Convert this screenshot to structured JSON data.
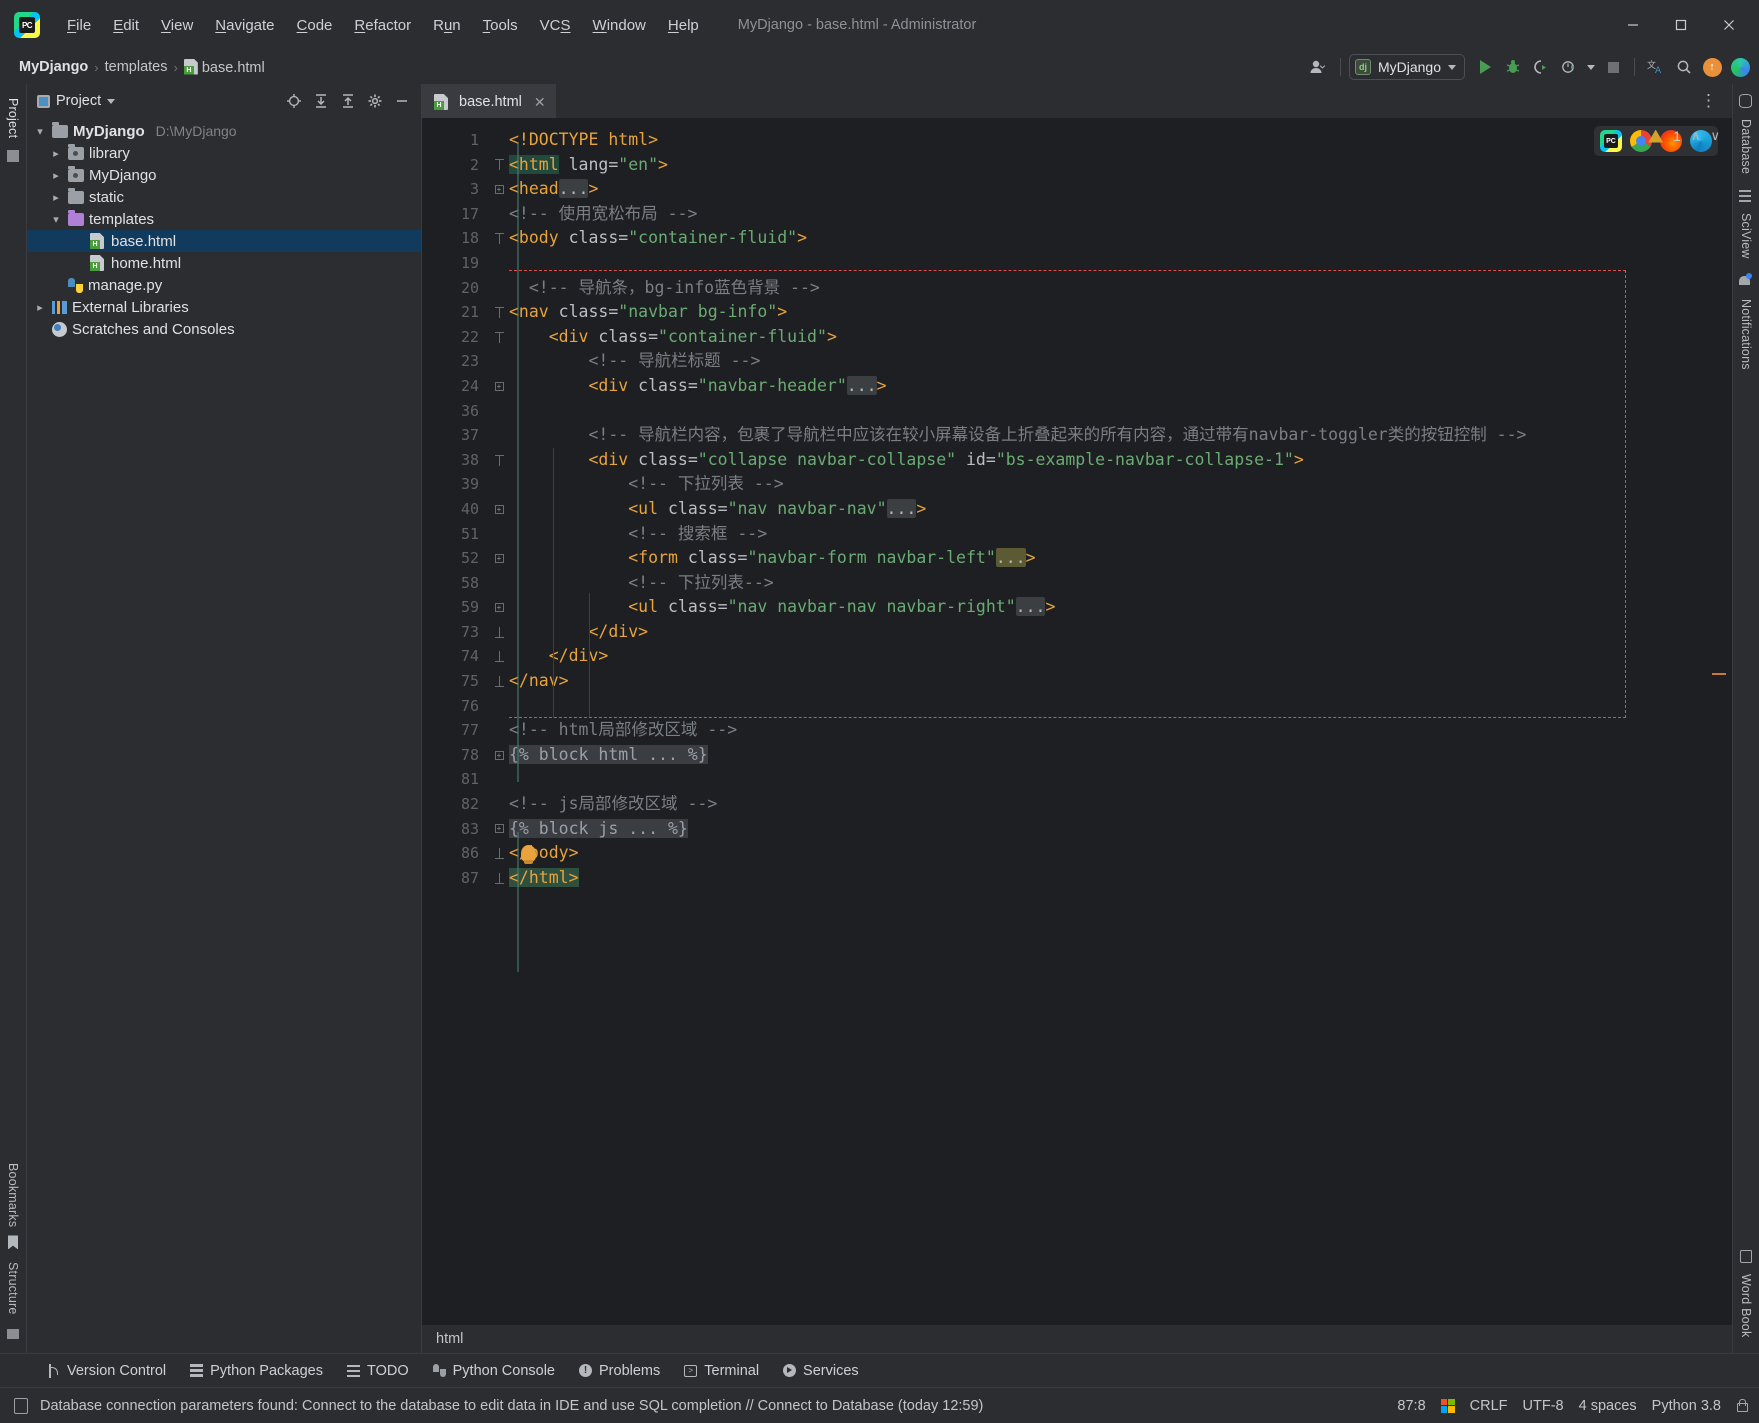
{
  "window": {
    "title": "MyDjango - base.html - Administrator",
    "minimize": "—",
    "maximize": "☐",
    "close": "✕"
  },
  "menu": {
    "items": [
      {
        "label": "File",
        "mnemonic": "F"
      },
      {
        "label": "Edit",
        "mnemonic": "E"
      },
      {
        "label": "View",
        "mnemonic": "V"
      },
      {
        "label": "Navigate",
        "mnemonic": "N"
      },
      {
        "label": "Code",
        "mnemonic": "C"
      },
      {
        "label": "Refactor",
        "mnemonic": "R"
      },
      {
        "label": "Run",
        "mnemonic": "u"
      },
      {
        "label": "Tools",
        "mnemonic": "T"
      },
      {
        "label": "VCS",
        "mnemonic": "S"
      },
      {
        "label": "Window",
        "mnemonic": "W"
      },
      {
        "label": "Help",
        "mnemonic": "H"
      }
    ]
  },
  "breadcrumb": {
    "project": "MyDjango",
    "folder": "templates",
    "file": "base.html",
    "separator": "›"
  },
  "toolbar": {
    "run_config": "MyDjango",
    "django_badge": "dj",
    "icons": [
      "user-account-icon",
      "run-icon",
      "debug-icon",
      "coverage-icon",
      "profile-icon",
      "stop-icon",
      "translate-icon",
      "search-everywhere-icon",
      "update-icon",
      "ai-assistant-icon"
    ]
  },
  "left_rail": {
    "top": [
      "Project"
    ],
    "bottom": [
      "Bookmarks",
      "Structure"
    ]
  },
  "right_rail": {
    "top": [
      "Database",
      "SciView",
      "Notifications"
    ],
    "bottom": [
      "Word Book"
    ]
  },
  "project_panel": {
    "title": "Project",
    "header_icons": [
      "locate-icon",
      "expand-all-icon",
      "collapse-all-icon",
      "settings-gear-icon",
      "hide-icon"
    ],
    "tree": [
      {
        "label": "MyDjango",
        "path": "D:\\MyDjango",
        "indent": 0,
        "chevron": "expanded",
        "icon": "folder",
        "bold": true,
        "selected": false
      },
      {
        "label": "library",
        "path": "",
        "indent": 1,
        "chevron": "collapsed",
        "icon": "folder-module",
        "bold": false,
        "selected": false
      },
      {
        "label": "MyDjango",
        "path": "",
        "indent": 1,
        "chevron": "collapsed",
        "icon": "folder-module",
        "bold": false,
        "selected": false
      },
      {
        "label": "static",
        "path": "",
        "indent": 1,
        "chevron": "collapsed",
        "icon": "folder",
        "bold": false,
        "selected": false
      },
      {
        "label": "templates",
        "path": "",
        "indent": 1,
        "chevron": "expanded",
        "icon": "folder-templates",
        "bold": false,
        "selected": false
      },
      {
        "label": "base.html",
        "path": "",
        "indent": 2,
        "chevron": "none",
        "icon": "html-file",
        "bold": false,
        "selected": true
      },
      {
        "label": "home.html",
        "path": "",
        "indent": 2,
        "chevron": "none",
        "icon": "html-file",
        "bold": false,
        "selected": false
      },
      {
        "label": "manage.py",
        "path": "",
        "indent": 1,
        "chevron": "none",
        "icon": "python-file",
        "bold": false,
        "selected": false
      },
      {
        "label": "External Libraries",
        "path": "",
        "indent": 0,
        "chevron": "collapsed",
        "icon": "library",
        "bold": false,
        "selected": false
      },
      {
        "label": "Scratches and Consoles",
        "path": "",
        "indent": 0,
        "chevron": "none",
        "icon": "scratches",
        "bold": false,
        "selected": false
      }
    ]
  },
  "editor": {
    "tab": {
      "label": "base.html",
      "close": "✕",
      "icon": "html-file"
    },
    "overflow_menu": "⋮",
    "inspection": {
      "warning_count": "1",
      "up": "∧",
      "down": "∨"
    },
    "browser_icons": [
      "pycharm-preview-icon",
      "chrome-icon",
      "firefox-icon",
      "edge-icon"
    ],
    "path_status": "html",
    "lines": [
      {
        "num": "1",
        "fold": "",
        "html": "<span class=\"tag\">&lt;!DOCTYPE html&gt;</span>"
      },
      {
        "num": "2",
        "fold": "down",
        "html": "<span class=\"hl\"><span class=\"tag\">&lt;html</span></span><span class=\"attr\"> lang=</span><span class=\"val\">\"en\"</span><span class=\"tag\">&gt;</span>"
      },
      {
        "num": "3",
        "fold": "plus",
        "html": "<span class=\"tag\">&lt;head</span><span class=\"ell\">...</span><span class=\"tag\">&gt;</span>"
      },
      {
        "num": "17",
        "fold": "",
        "html": "<span class=\"cmt\">&lt;!-- 使用宽松布局 --&gt;</span>"
      },
      {
        "num": "18",
        "fold": "down",
        "html": "<span class=\"tag\">&lt;body</span><span class=\"attr\"> class=</span><span class=\"val\">\"container-fluid\"</span><span class=\"tag\">&gt;</span>"
      },
      {
        "num": "19",
        "fold": "",
        "html": ""
      },
      {
        "num": "20",
        "fold": "",
        "html": "  <span class=\"cmt\">&lt;!-- 导航条，bg-info蓝色背景 --&gt;</span>"
      },
      {
        "num": "21",
        "fold": "down",
        "html": "<span class=\"tag\">&lt;nav</span><span class=\"attr\"> class=</span><span class=\"val\">\"navbar bg-info\"</span><span class=\"tag\">&gt;</span>"
      },
      {
        "num": "22",
        "fold": "down",
        "html": "    <span class=\"tag\">&lt;div</span><span class=\"attr\"> class=</span><span class=\"val\">\"container-fluid\"</span><span class=\"tag\">&gt;</span>"
      },
      {
        "num": "23",
        "fold": "",
        "html": "        <span class=\"cmt\">&lt;!-- 导航栏标题 --&gt;</span>"
      },
      {
        "num": "24",
        "fold": "plus",
        "html": "        <span class=\"tag\">&lt;div</span><span class=\"attr\"> class=</span><span class=\"val\">\"navbar-header\"</span><span class=\"ell\">...</span><span class=\"tag\">&gt;</span>"
      },
      {
        "num": "36",
        "fold": "",
        "html": ""
      },
      {
        "num": "37",
        "fold": "",
        "html": "        <span class=\"cmt\">&lt;!-- 导航栏内容，包裹了导航栏中应该在较小屏幕设备上折叠起来的所有内容，通过带有navbar-toggler类的按钮控制 --&gt;</span>"
      },
      {
        "num": "38",
        "fold": "down",
        "html": "        <span class=\"tag\">&lt;div</span><span class=\"attr\"> class=</span><span class=\"val\">\"collapse navbar-collapse\"</span><span class=\"attr\"> id=</span><span class=\"val\">\"bs-example-navbar-collapse-1\"</span><span class=\"tag\">&gt;</span>"
      },
      {
        "num": "39",
        "fold": "",
        "html": "            <span class=\"cmt\">&lt;!-- 下拉列表 --&gt;</span>"
      },
      {
        "num": "40",
        "fold": "plus",
        "html": "            <span class=\"tag\">&lt;ul</span><span class=\"attr\"> class=</span><span class=\"val\">\"nav navbar-nav\"</span><span class=\"ell\">...</span><span class=\"tag\">&gt;</span>"
      },
      {
        "num": "51",
        "fold": "",
        "html": "            <span class=\"cmt\">&lt;!-- 搜索框 --&gt;</span>"
      },
      {
        "num": "52",
        "fold": "plus",
        "html": "            <span class=\"tag\">&lt;form</span><span class=\"attr\"> class=</span><span class=\"val\">\"navbar-form navbar-left\"</span><span class=\"ell olive\">...</span><span class=\"tag\">&gt;</span>"
      },
      {
        "num": "58",
        "fold": "",
        "html": "            <span class=\"cmt\">&lt;!-- 下拉列表--&gt;</span>"
      },
      {
        "num": "59",
        "fold": "plus",
        "html": "            <span class=\"tag\">&lt;ul</span><span class=\"attr\"> class=</span><span class=\"val\">\"nav navbar-nav navbar-right\"</span><span class=\"ell\">...</span><span class=\"tag\">&gt;</span>"
      },
      {
        "num": "73",
        "fold": "up",
        "html": "        <span class=\"tag\">&lt;/div&gt;</span>"
      },
      {
        "num": "74",
        "fold": "up",
        "html": "    <span class=\"tag\">&lt;/div&gt;</span>"
      },
      {
        "num": "75",
        "fold": "up",
        "html": "<span class=\"tag\">&lt;/nav&gt;</span>"
      },
      {
        "num": "76",
        "fold": "",
        "html": ""
      },
      {
        "num": "77",
        "fold": "",
        "html": "<span class=\"cmt\">&lt;!-- html局部修改区域 --&gt;</span>"
      },
      {
        "num": "78",
        "fold": "plus",
        "html": "<span class=\"blockhl\">{% block html ... %}</span>"
      },
      {
        "num": "81",
        "fold": "",
        "html": ""
      },
      {
        "num": "82",
        "fold": "",
        "html": "<span class=\"cmt\">&lt;!-- js局部修改区域 --&gt;</span>"
      },
      {
        "num": "83",
        "fold": "plus",
        "html": "<span class=\"blockhl\">{% block js ... %}</span>"
      },
      {
        "num": "86",
        "fold": "up",
        "html": "<span class=\"tag\">&lt;/body&gt;</span>"
      },
      {
        "num": "87",
        "fold": "up",
        "html": "<span class=\"hl2\"><span class=\"tag\">&lt;/html&gt;</span></span>"
      }
    ]
  },
  "tool_windows": {
    "items": [
      {
        "label": "Version Control",
        "icon": "version-control-icon"
      },
      {
        "label": "Python Packages",
        "icon": "python-packages-icon"
      },
      {
        "label": "TODO",
        "icon": "todo-icon"
      },
      {
        "label": "Python Console",
        "icon": "python-console-icon"
      },
      {
        "label": "Problems",
        "icon": "problems-icon"
      },
      {
        "label": "Terminal",
        "icon": "terminal-icon"
      },
      {
        "label": "Services",
        "icon": "services-icon"
      }
    ]
  },
  "status_bar": {
    "message": "Database connection parameters found: Connect to the database to edit data in IDE and use SQL completion // Connect to Database (today 12:59)",
    "caret": "87:8",
    "line_separator": "CRLF",
    "encoding": "UTF-8",
    "indent": "4 spaces",
    "interpreter": "Python 3.8",
    "icons": [
      "database-icon",
      "windows-os-icon",
      "lock-icon"
    ]
  }
}
